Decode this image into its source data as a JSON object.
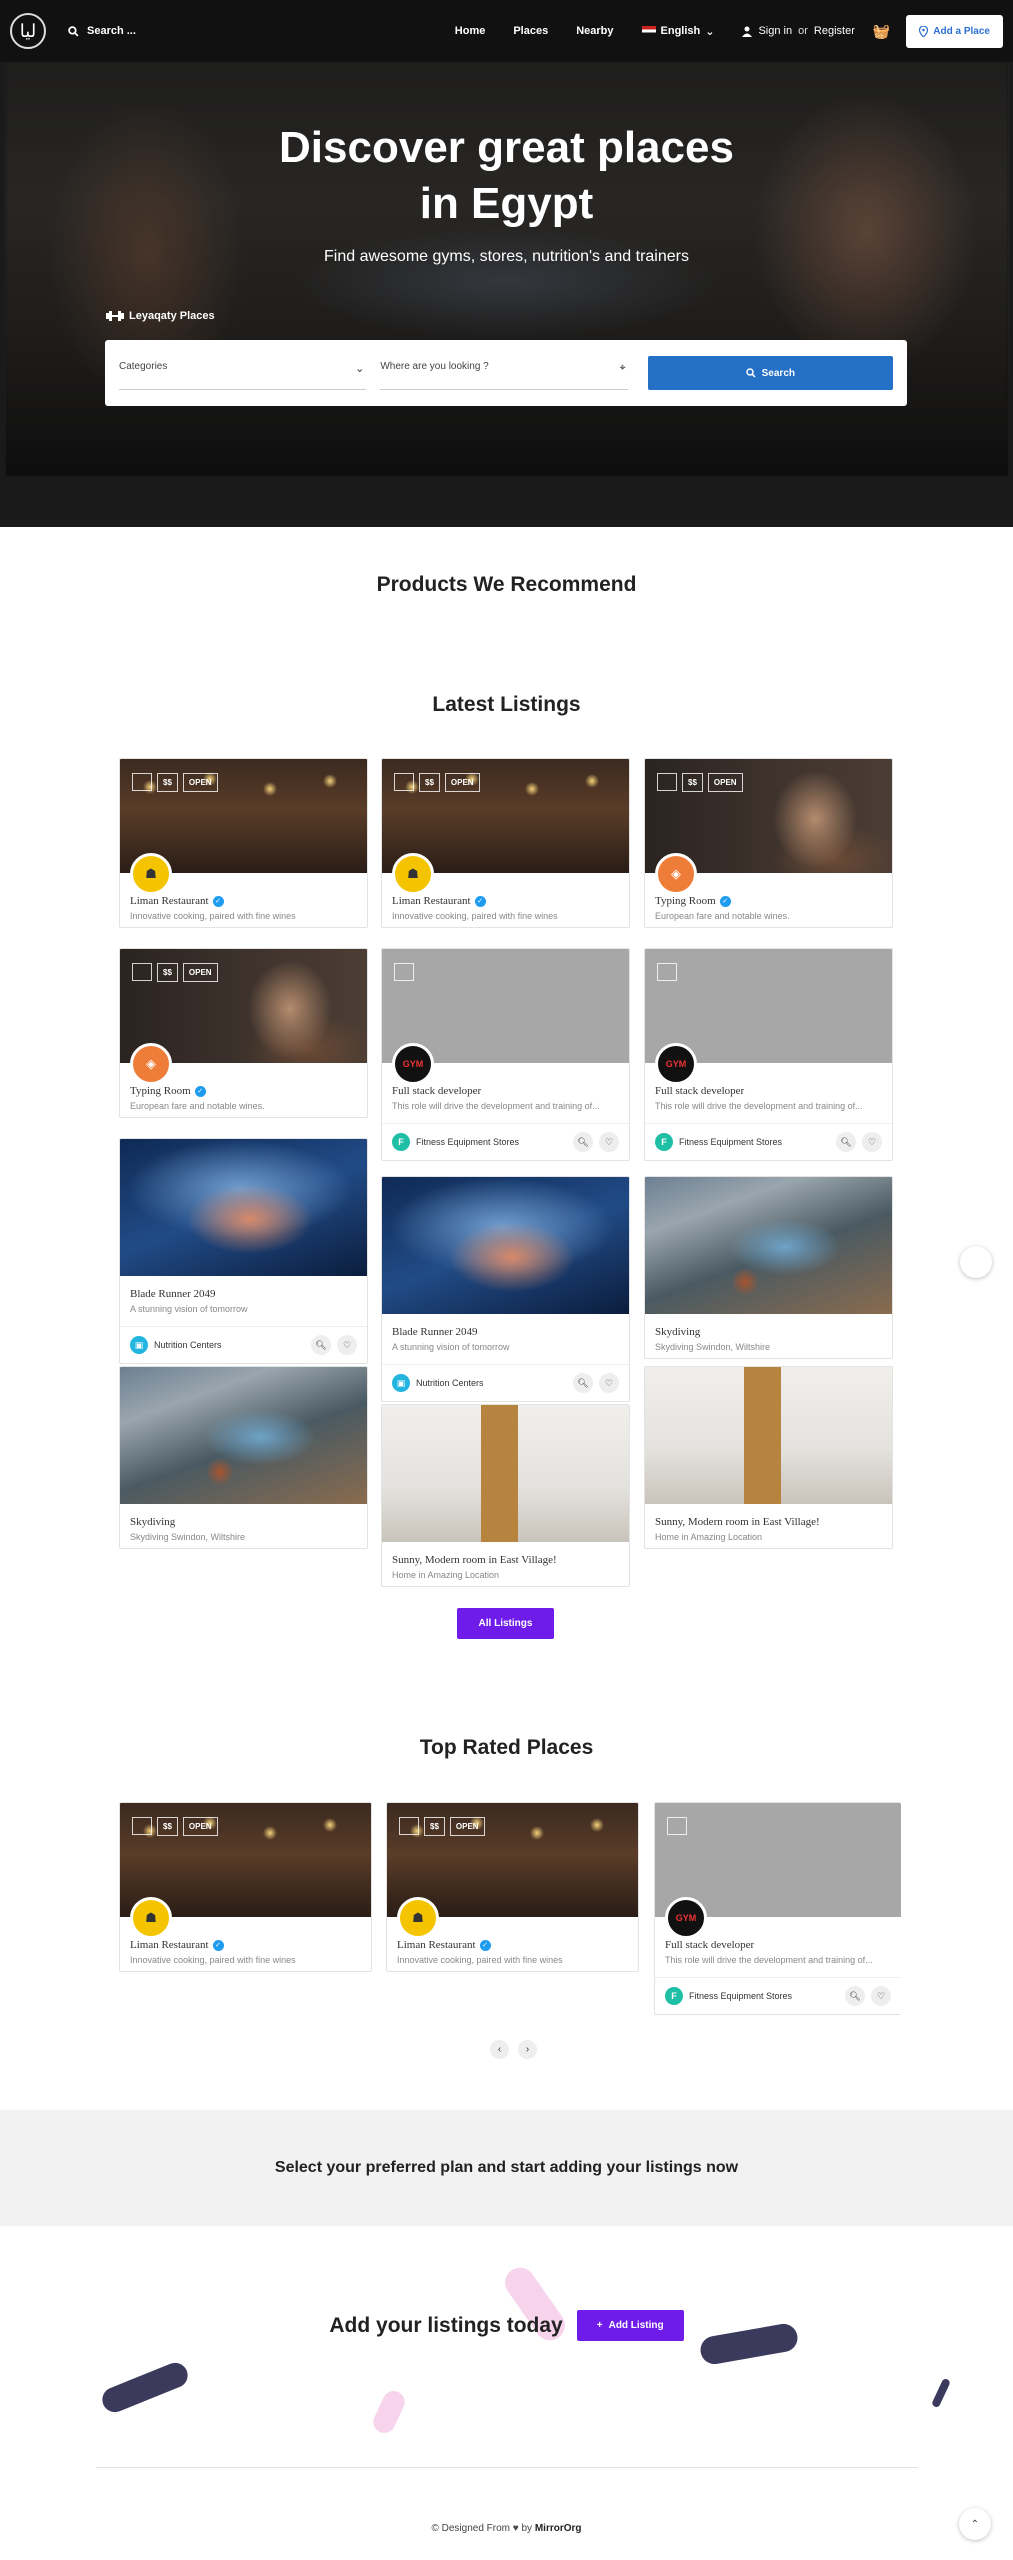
{
  "header": {
    "logo": "ليا",
    "search_label": "Search ...",
    "nav": [
      "Home",
      "Places",
      "Nearby"
    ],
    "language": "English",
    "signin": "Sign in",
    "or": "or",
    "register": "Register",
    "add_place": "Add a Place"
  },
  "hero": {
    "title_line1": "Discover great places",
    "title_line2": "in Egypt",
    "subtitle": "Find awesome gyms, stores, nutrition's and trainers",
    "brand": "Leyaqaty Places",
    "categories_placeholder": "Categories",
    "where_placeholder": "Where are you looking ?",
    "search_button": "Search"
  },
  "sections": {
    "recommend": "Products We Recommend",
    "latest": "Latest Listings",
    "all_listings": "All Listings",
    "top_rated": "Top Rated Places",
    "plan": "Select your preferred plan and start adding your listings now",
    "cta_text": "Add your listings today",
    "cta_button": "Add Listing"
  },
  "listings": [
    {
      "title": "Liman Restaurant",
      "desc": "Innovative cooking, paired with fine wines",
      "price": "$$",
      "status": "OPEN"
    },
    {
      "title": "Liman Restaurant",
      "desc": "Innovative cooking, paired with fine wines",
      "price": "$$",
      "status": "OPEN"
    },
    {
      "title": "Typing Room",
      "desc": "European fare and notable wines.",
      "price": "$$",
      "status": "OPEN"
    },
    {
      "title": "Typing Room",
      "desc": "European fare and notable wines.",
      "price": "$$",
      "status": "OPEN"
    },
    {
      "title": "Full stack developer",
      "desc": "This role will drive the development and training of...",
      "category": "Fitness Equipment Stores"
    },
    {
      "title": "Full stack developer",
      "desc": "This role will drive the development and training of...",
      "category": "Fitness Equipment Stores"
    },
    {
      "title": "Blade Runner 2049",
      "desc": "A stunning vision of tomorrow",
      "category": "Nutrition Centers"
    },
    {
      "title": "Blade Runner 2049",
      "desc": "A stunning vision of tomorrow",
      "category": "Nutrition Centers"
    },
    {
      "title": "Skydiving",
      "desc": "Skydiving Swindon, Wiltshire"
    },
    {
      "title": "Skydiving",
      "desc": "Skydiving Swindon, Wiltshire"
    },
    {
      "title": "Sunny, Modern room in East Village!",
      "desc": "Home in Amazing Location"
    },
    {
      "title": "Sunny, Modern room in East Village!",
      "desc": "Home in Amazing Location"
    }
  ],
  "top_rated": [
    {
      "title": "Liman Restaurant",
      "desc": "Innovative cooking, paired with fine wines",
      "price": "$$",
      "status": "OPEN"
    },
    {
      "title": "Liman Restaurant",
      "desc": "Innovative cooking, paired with fine wines",
      "price": "$$",
      "status": "OPEN"
    },
    {
      "title": "Full stack developer",
      "desc": "This role will drive the development and training of...",
      "category": "Fitness Equipment Stores"
    }
  ],
  "footer": {
    "designed": "© Designed From",
    "by": "by",
    "org": "MirrorOrg"
  },
  "colors": {
    "primary": "#2470c6",
    "accent_purple": "#6f1bea",
    "pill_navy": "#3b3a5c",
    "pill_pink": "#f7d4ec"
  }
}
